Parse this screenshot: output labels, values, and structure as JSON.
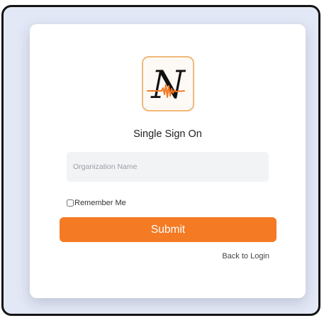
{
  "logo": {
    "icon": "n-waveform-logo-icon",
    "letter": "N",
    "accent_color": "#f47a24",
    "border_color": "#f1b97a"
  },
  "form": {
    "title": "Single Sign On",
    "organization_placeholder": "Organization Name",
    "organization_value": "",
    "remember_label": "Remember Me",
    "remember_checked": false,
    "submit_label": "Submit",
    "back_label": "Back to Login"
  },
  "colors": {
    "background": "#e3e8f6",
    "card": "#ffffff",
    "button": "#f47a24",
    "input_bg": "#f2f3f5"
  }
}
